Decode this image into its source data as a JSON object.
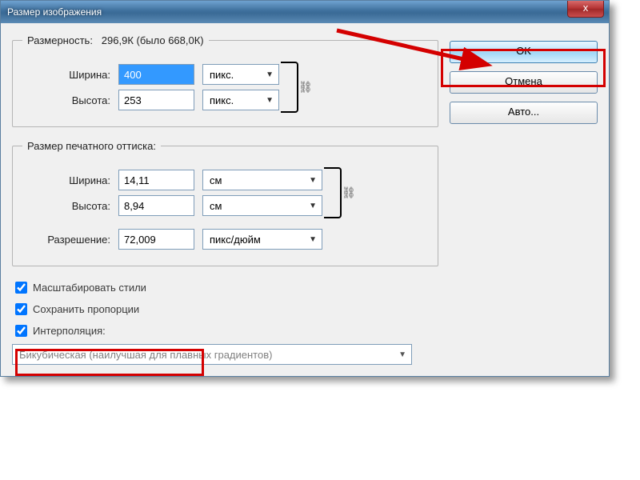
{
  "window": {
    "title": "Размер изображения",
    "close_glyph": "x"
  },
  "dim_group": {
    "legend_prefix": "Размерность:",
    "legend_value": "296,9К (было 668,0К)",
    "width_label": "Ширина:",
    "width_value": "400",
    "width_unit": "пикс.",
    "height_label": "Высота:",
    "height_value": "253",
    "height_unit": "пикс.",
    "link_icon": "⛓"
  },
  "print_group": {
    "legend": "Размер печатного оттиска:",
    "width_label": "Ширина:",
    "width_value": "14,11",
    "width_unit": "см",
    "height_label": "Высота:",
    "height_value": "8,94",
    "height_unit": "см",
    "res_label": "Разрешение:",
    "res_value": "72,009",
    "res_unit": "пикс/дюйм",
    "link_icon": "⛓"
  },
  "checks": {
    "scale_styles": "Масштабировать стили",
    "constrain": "Сохранить пропорции",
    "interp_label": "Интерполяция:"
  },
  "interp_select": "Бикубическая (наилучшая для плавных градиентов)",
  "buttons": {
    "ok": "OK",
    "cancel": "Отмена",
    "auto": "Авто..."
  }
}
